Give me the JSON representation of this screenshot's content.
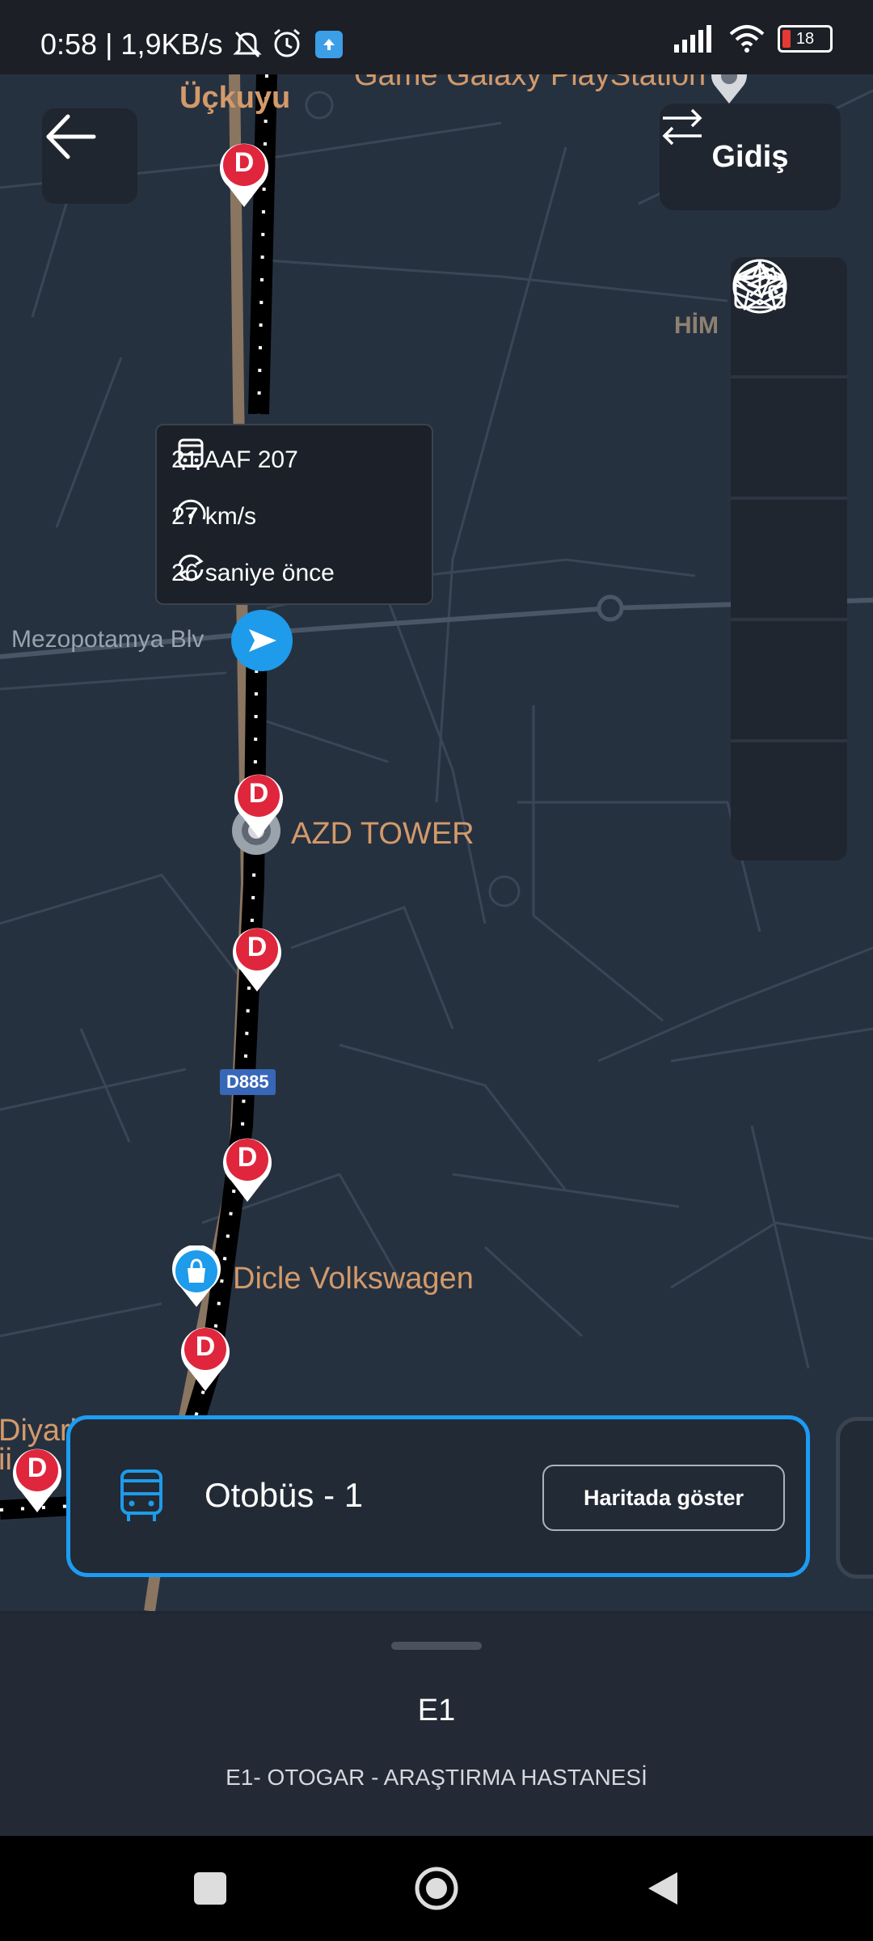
{
  "status_bar": {
    "time_text": "0:58 | 1,9KB/s",
    "battery": "18"
  },
  "map": {
    "labels": {
      "poi_top": "Game Galaxy PlayStation",
      "district": "Üçkuyu",
      "area_right": "HİM",
      "street": "Mezopotamya Blv",
      "poi_tower": "AZD TOWER",
      "road_badge": "D885",
      "poi_dealer": "Dicle Volkswagen",
      "edge_text_1": "Diyarb",
      "edge_text_2": "ii"
    },
    "stop_marker_letter": "D",
    "direction_label": "Gidiş",
    "vehicle_info": {
      "plate": "21 AAF 207",
      "speed": "27 km/s",
      "updated": "26 saniye önce"
    }
  },
  "route_card": {
    "name": "Otobüs - 1",
    "button_label": "Haritada göster"
  },
  "sheet": {
    "line_code": "E1",
    "line_description": "E1- OTOGAR - ARAŞTIRMA HASTANESİ"
  },
  "colors": {
    "accent": "#1c9cf2",
    "stop_marker": "#e0263c",
    "vehicle": "#1e9bea",
    "map_bg": "#263140"
  }
}
